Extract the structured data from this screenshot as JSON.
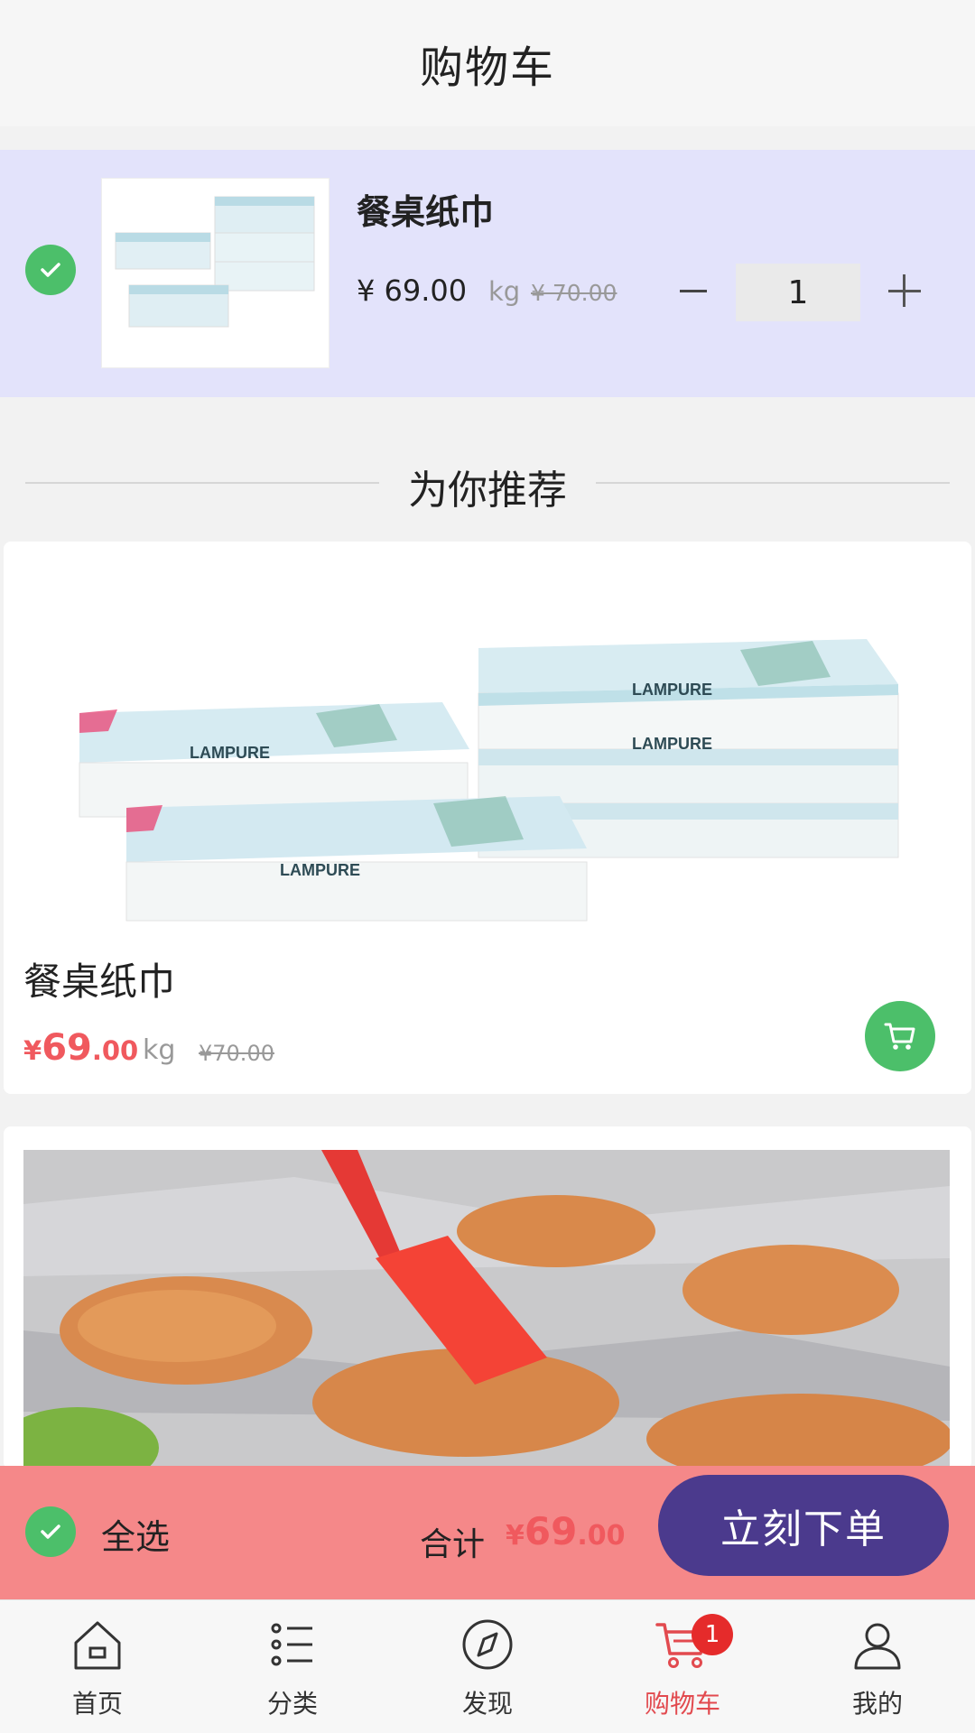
{
  "header": {
    "title": "购物车"
  },
  "cart_item": {
    "name": "餐桌纸巾",
    "price": "¥ 69.00",
    "unit": "kg",
    "original_price": "¥ 70.00",
    "quantity": "1",
    "selected": true
  },
  "recommend": {
    "title": "为你推荐",
    "products": [
      {
        "name": "餐桌纸巾",
        "price_symbol": "¥",
        "price_int": "69",
        "price_dec": ".00",
        "unit": "kg",
        "original_price": "¥70.00",
        "brand_text": "LAMPURE"
      }
    ]
  },
  "checkout": {
    "select_all": "全选",
    "total_label": "合计",
    "total_symbol": "¥",
    "total_int": "69",
    "total_dec": ".00",
    "order_button": "立刻下单"
  },
  "bottom_nav": {
    "items": [
      {
        "label": "首页",
        "icon": "home-icon"
      },
      {
        "label": "分类",
        "icon": "list-icon"
      },
      {
        "label": "发现",
        "icon": "compass-icon"
      },
      {
        "label": "购物车",
        "icon": "cart-icon",
        "badge": "1",
        "active": true
      },
      {
        "label": "我的",
        "icon": "user-icon"
      }
    ]
  },
  "colors": {
    "accent_green": "#4cbf6a",
    "price_red": "#f0595e",
    "checkout_bg": "#f58889",
    "order_button": "#4b3a8d",
    "cart_item_bg": "#e3e3fb",
    "active_nav": "#e24a4f"
  }
}
